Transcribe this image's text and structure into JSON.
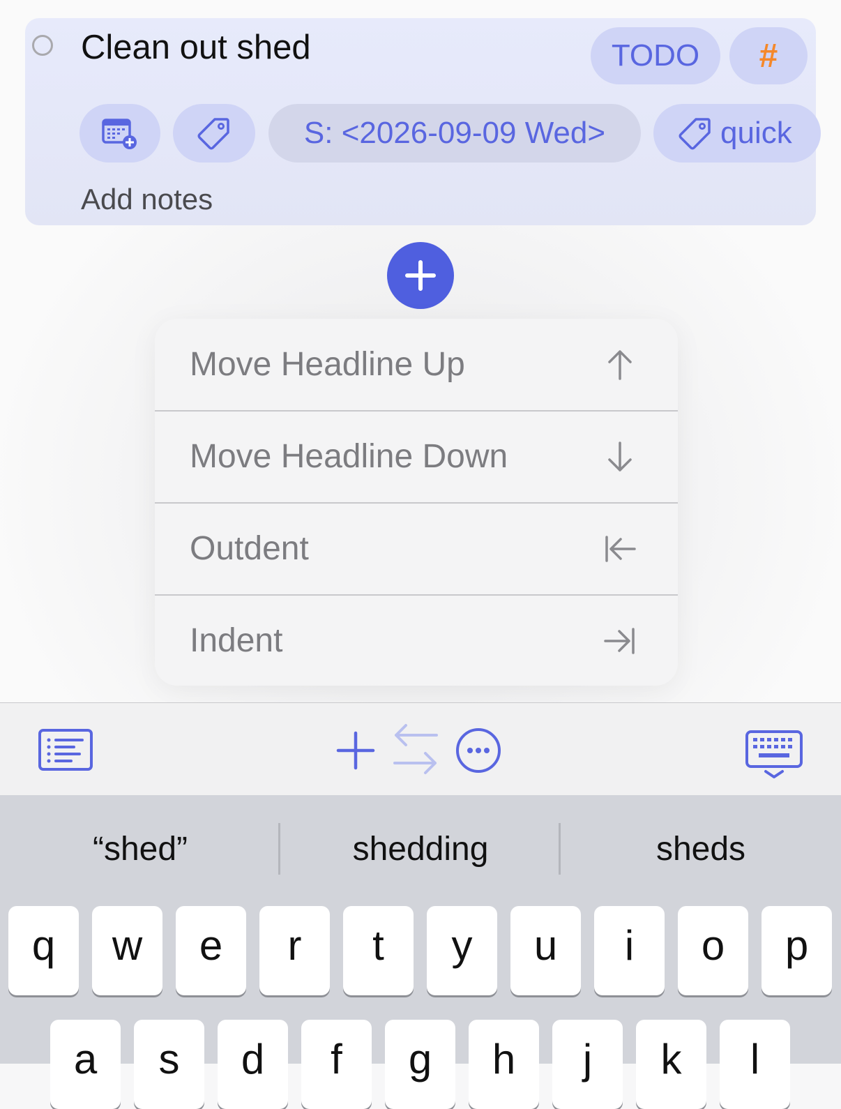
{
  "task": {
    "title": "Clean out shed",
    "state": "TODO",
    "priority_symbol": "#",
    "scheduled": "S: <2026-09-09 Wed>",
    "tag": "quick",
    "notes_placeholder": "Add notes"
  },
  "menu": {
    "items": [
      {
        "label": "Move Headline Up",
        "icon": "arrow-up-icon"
      },
      {
        "label": "Move Headline Down",
        "icon": "arrow-down-icon"
      },
      {
        "label": "Outdent",
        "icon": "outdent-icon"
      },
      {
        "label": "Indent",
        "icon": "indent-icon"
      }
    ]
  },
  "toolbar": {
    "icons": [
      "outline-list-icon",
      "plus-icon",
      "swap-arrows-icon",
      "more-ellipsis-icon",
      "keyboard-dismiss-icon"
    ]
  },
  "keyboard": {
    "suggestions": [
      "“shed”",
      "shedding",
      "sheds"
    ],
    "row1": [
      "q",
      "w",
      "e",
      "r",
      "t",
      "y",
      "u",
      "i",
      "o",
      "p"
    ],
    "row2": [
      "a",
      "s",
      "d",
      "f",
      "g",
      "h",
      "j",
      "k",
      "l"
    ]
  },
  "colors": {
    "accent": "#4f5fdf",
    "card_bg": "#e5e8f8",
    "pill_bg": "#cfd4f6",
    "priority": "#f5882a",
    "menu_text": "#7c7c80"
  }
}
